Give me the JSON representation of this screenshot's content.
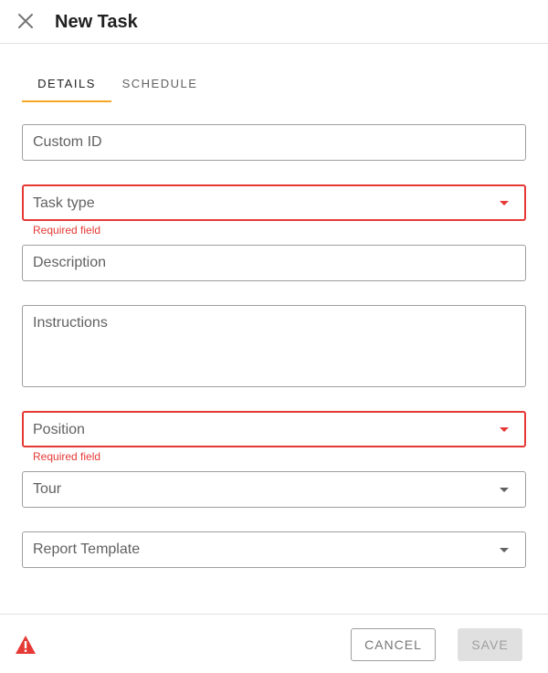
{
  "header": {
    "title": "New Task",
    "close_icon": "close-icon"
  },
  "tabs": [
    {
      "label": "DETAILS",
      "active": true
    },
    {
      "label": "SCHEDULE",
      "active": false
    }
  ],
  "form": {
    "custom_id": {
      "placeholder": "Custom ID",
      "value": ""
    },
    "task_type": {
      "placeholder": "Task type",
      "value": "",
      "error": "Required field"
    },
    "description": {
      "placeholder": "Description",
      "value": ""
    },
    "instructions": {
      "placeholder": "Instructions",
      "value": ""
    },
    "position": {
      "placeholder": "Position",
      "value": "",
      "error": "Required field"
    },
    "tour": {
      "placeholder": "Tour",
      "value": ""
    },
    "report_template": {
      "placeholder": "Report Template",
      "value": ""
    }
  },
  "footer": {
    "warning_icon": "warning-icon",
    "cancel_label": "CANCEL",
    "save_label": "SAVE"
  },
  "colors": {
    "accent": "#f5a623",
    "error": "#e53935",
    "border": "#9e9e9e",
    "disabled_bg": "#e0e0e0"
  }
}
